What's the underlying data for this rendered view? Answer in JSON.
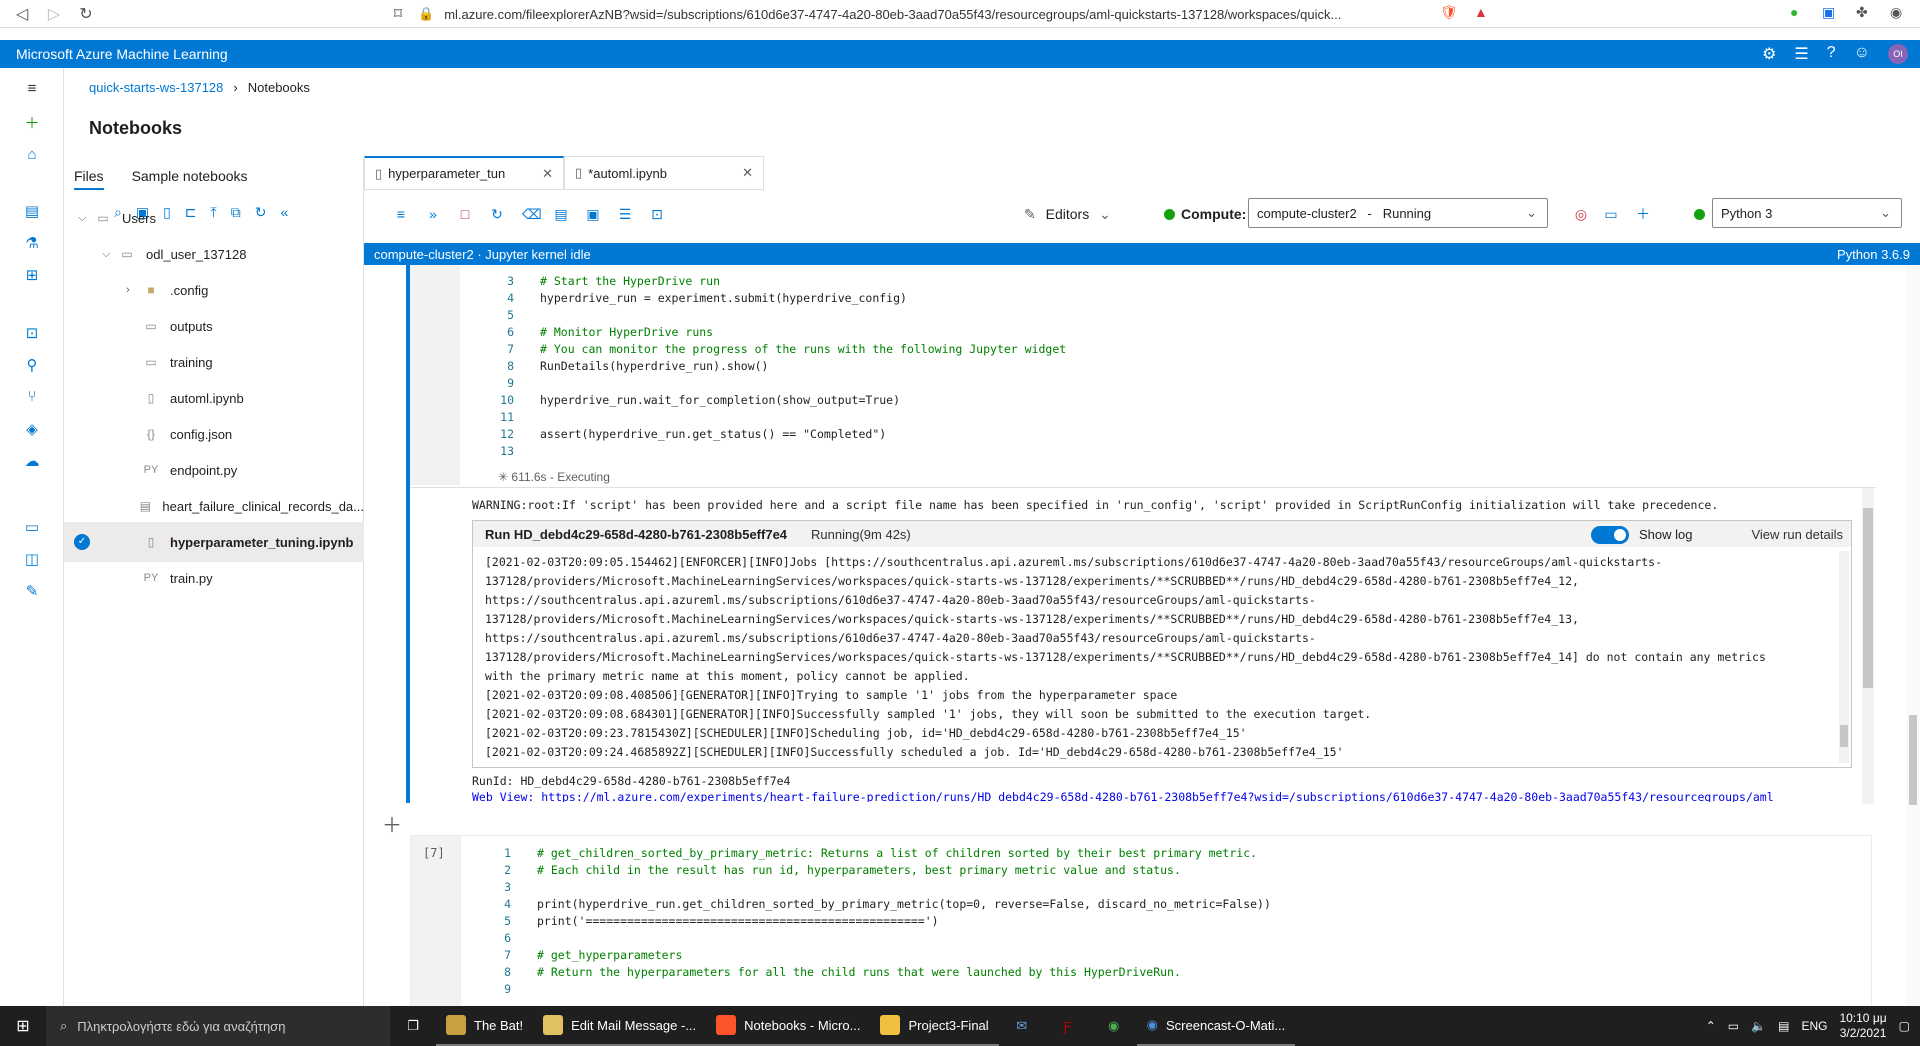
{
  "browser": {
    "url": "ml.azure.com/fileexplorerAzNB?wsid=/subscriptions/610d6e37-4747-4a20-80eb-3aad70a55f43/resourcegroups/aml-quickstarts-137128/workspaces/quick..."
  },
  "app": {
    "title": "Microsoft Azure Machine Learning",
    "avatar_initials": "OI"
  },
  "breadcrumb": {
    "workspace": "quick-starts-ws-137128",
    "current": "Notebooks"
  },
  "page_title": "Notebooks",
  "files_panel": {
    "tabs": [
      "Files",
      "Sample notebooks"
    ],
    "tree": [
      {
        "label": "Users",
        "icon": "folder-icon",
        "indent": 0,
        "chevron": "⌵"
      },
      {
        "label": "odl_user_137128",
        "icon": "folder-icon",
        "indent": 1,
        "chevron": "⌵"
      },
      {
        "label": ".config",
        "icon": "folder-filled-icon",
        "indent": 2,
        "chevron": "›"
      },
      {
        "label": "outputs",
        "icon": "folder-icon",
        "indent": 2,
        "chevron": ""
      },
      {
        "label": "training",
        "icon": "folder-icon",
        "indent": 2,
        "chevron": ""
      },
      {
        "label": "automl.ipynb",
        "icon": "notebook-icon",
        "indent": 2,
        "chevron": ""
      },
      {
        "label": "config.json",
        "icon": "json-icon",
        "indent": 2,
        "chevron": ""
      },
      {
        "label": "endpoint.py",
        "icon": "python-icon",
        "indent": 2,
        "chevron": ""
      },
      {
        "label": "heart_failure_clinical_records_da...",
        "icon": "file-icon",
        "indent": 2,
        "chevron": ""
      },
      {
        "label": "hyperparameter_tuning.ipynb",
        "icon": "notebook-icon",
        "indent": 2,
        "chevron": "",
        "selected": true
      },
      {
        "label": "train.py",
        "icon": "python-icon",
        "indent": 2,
        "chevron": ""
      }
    ],
    "icon_labels": {
      "py": "PY",
      "json": "{}"
    }
  },
  "notebook_tabs": [
    {
      "label": "hyperparameter_tun",
      "active": true
    },
    {
      "label": "*automl.ipynb",
      "active": false
    }
  ],
  "toolbar": {
    "editors_label": "Editors",
    "compute_label": "Compute:",
    "compute_value": "compute-cluster2   -   Running",
    "kernel_value": "Python 3"
  },
  "status": {
    "left": "compute-cluster2 · Jupyter kernel idle",
    "right": "Python 3.6.9"
  },
  "cell1": {
    "lines": [
      {
        "n": "3",
        "text": "# Start the HyperDrive run",
        "cls": "cm"
      },
      {
        "n": "4",
        "text": "hyperdrive_run = experiment.submit(hyperdrive_config)",
        "cls": ""
      },
      {
        "n": "5",
        "text": "",
        "cls": ""
      },
      {
        "n": "6",
        "text": "# Monitor HyperDrive runs",
        "cls": "cm"
      },
      {
        "n": "7",
        "text": "# You can monitor the progress of the runs with the following Jupyter widget",
        "cls": "cm"
      },
      {
        "n": "8",
        "text": "RunDetails(hyperdrive_run).show()",
        "cls": ""
      },
      {
        "n": "9",
        "text": "",
        "cls": ""
      },
      {
        "n": "10",
        "text": "hyperdrive_run.wait_for_completion(show_output=True)",
        "cls": "",
        "kw": "True"
      },
      {
        "n": "11",
        "text": "",
        "cls": ""
      },
      {
        "n": "12",
        "text": "assert(hyperdrive_run.get_status() == \"Completed\")",
        "cls": "",
        "kw": "assert",
        "str": "\"Completed\""
      },
      {
        "n": "13",
        "text": "",
        "cls": ""
      }
    ],
    "exec_status": "611.6s - Executing",
    "warning": "WARNING:root:If 'script' has been provided here and a script file name has been specified in 'run_config', 'script' provided in ScriptRunConfig initialization will take precedence.",
    "widget": {
      "run_title": "Run HD_debd4c29-658d-4280-b761-2308b5eff7e4",
      "run_status": "Running(9m 42s)",
      "show_log": "Show log",
      "view_details": "View run details",
      "log": [
        "[2021-02-03T20:09:05.154462][ENFORCER][INFO]Jobs [https://southcentralus.api.azureml.ms/subscriptions/610d6e37-4747-4a20-80eb-3aad70a55f43/resourceGroups/aml-quickstarts-",
        "137128/providers/Microsoft.MachineLearningServices/workspaces/quick-starts-ws-137128/experiments/**SCRUBBED**/runs/HD_debd4c29-658d-4280-b761-2308b5eff7e4_12,",
        "https://southcentralus.api.azureml.ms/subscriptions/610d6e37-4747-4a20-80eb-3aad70a55f43/resourceGroups/aml-quickstarts-",
        "137128/providers/Microsoft.MachineLearningServices/workspaces/quick-starts-ws-137128/experiments/**SCRUBBED**/runs/HD_debd4c29-658d-4280-b761-2308b5eff7e4_13,",
        "https://southcentralus.api.azureml.ms/subscriptions/610d6e37-4747-4a20-80eb-3aad70a55f43/resourceGroups/aml-quickstarts-",
        "137128/providers/Microsoft.MachineLearningServices/workspaces/quick-starts-ws-137128/experiments/**SCRUBBED**/runs/HD_debd4c29-658d-4280-b761-2308b5eff7e4_14] do not contain any metrics",
        "with the primary metric name at this moment, policy cannot be applied.",
        "[2021-02-03T20:09:08.408506][GENERATOR][INFO]Trying to sample '1' jobs from the hyperparameter space",
        "[2021-02-03T20:09:08.684301][GENERATOR][INFO]Successfully sampled '1' jobs, they will soon be submitted to the execution target.",
        "[2021-02-03T20:09:23.7815430Z][SCHEDULER][INFO]Scheduling job, id='HD_debd4c29-658d-4280-b761-2308b5eff7e4_15'",
        "[2021-02-03T20:09:24.4685892Z][SCHEDULER][INFO]Successfully scheduled a job. Id='HD_debd4c29-658d-4280-b761-2308b5eff7e4_15'"
      ]
    },
    "run_id": "RunId: HD_debd4c29-658d-4280-b761-2308b5eff7e4",
    "web_view": "Web View: https://ml.azure.com/experiments/heart-failure-prediction/runs/HD_debd4c29-658d-4280-b761-2308b5eff7e4?wsid=/subscriptions/610d6e37-4747-4a20-80eb-3aad70a55f43/resourcegroups/aml"
  },
  "cell2": {
    "count": "[7]",
    "lines": [
      {
        "n": "1",
        "text": "# get_children_sorted_by_primary_metric: Returns a list of children sorted by their best primary metric.",
        "cls": "cm"
      },
      {
        "n": "2",
        "text": "# Each child in the result has run id, hyperparameters, best primary metric value and status.",
        "cls": "cm"
      },
      {
        "n": "3",
        "text": "",
        "cls": ""
      },
      {
        "n": "4",
        "text": "print(hyperdrive_run.get_children_sorted_by_primary_metric(top=0, reverse=False, discard_no_metric=False))",
        "cls": ""
      },
      {
        "n": "5",
        "text": "print('=================================================')",
        "cls": ""
      },
      {
        "n": "6",
        "text": "",
        "cls": ""
      },
      {
        "n": "7",
        "text": "# get_hyperparameters",
        "cls": "cm"
      },
      {
        "n": "8",
        "text": "# Return the hyperparameters for all the child runs that were launched by this HyperDriveRun.",
        "cls": "cm"
      },
      {
        "n": "9",
        "text": "",
        "cls": ""
      }
    ]
  },
  "taskbar": {
    "search_placeholder": "Πληκτρολογήστε εδώ για αναζήτηση",
    "apps": [
      {
        "label": "The Bat!",
        "color": "#c8a040"
      },
      {
        "label": "Edit Mail Message -...",
        "color": "#e0c060"
      },
      {
        "label": "Notebooks - Micro...",
        "color": "#fb542b"
      },
      {
        "label": "Project3-Final",
        "color": "#f0c040"
      }
    ],
    "screencast_label": "Screencast-O-Mati...",
    "language": "ENG",
    "time": "10:10 μμ",
    "date": "3/2/2021"
  }
}
